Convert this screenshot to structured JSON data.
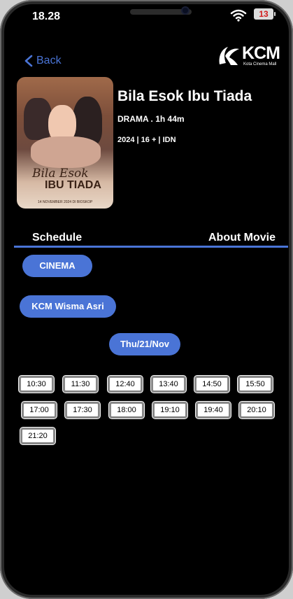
{
  "status": {
    "time": "18.28",
    "battery": "13"
  },
  "nav": {
    "back_label": "Back"
  },
  "logo": {
    "brand": "KCM",
    "subtitle": "Kota Cinema Mall"
  },
  "movie": {
    "title": "Bila Esok Ibu Tiada",
    "genre_duration": "DRAMA . 1h 44m",
    "meta": "2024 | 16 + | IDN",
    "poster_title_line1": "Bila Esok",
    "poster_title_line2": "IBU TIADA",
    "poster_date": "14 NOVEMBER 2024 DI BIOSKOP"
  },
  "tabs": {
    "schedule": "Schedule",
    "about": "About Movie"
  },
  "filters": {
    "cinema_label": "CINEMA",
    "location": "KCM Wisma Asri",
    "date": "Thu/21/Nov"
  },
  "showtimes": [
    "10:30",
    "11:30",
    "12:40",
    "13:40",
    "14:50",
    "15:50",
    "17:00",
    "17:30",
    "18:00",
    "19:10",
    "19:40",
    "20:10",
    "21:20"
  ],
  "colors": {
    "accent": "#4a74d6",
    "background": "#000000",
    "text": "#ffffff"
  }
}
